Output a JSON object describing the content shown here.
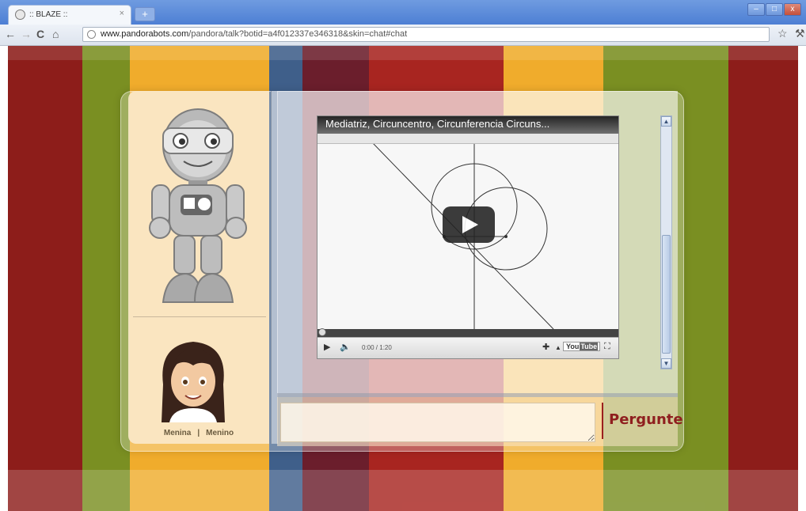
{
  "browser": {
    "tab_title": ":: BLAZE ::",
    "tab_close": "×",
    "new_tab": "+",
    "url_domain": "www.pandorabots.com",
    "url_path": "/pandora/talk?botid=a4f012337e346318&skin=chat#chat",
    "window_buttons": [
      "–",
      "□",
      "x"
    ]
  },
  "video": {
    "title": "Mediatriz, Circuncentro, Circunferencia Circuns...",
    "time": "0:00 / 1:20",
    "logo_you": "You",
    "logo_tube": "Tube"
  },
  "character_switch": {
    "girl": "Menina",
    "separator": "|",
    "boy": "Menino"
  },
  "input": {
    "value": "",
    "button": "Pergunte"
  },
  "colors": {
    "stripes": [
      "#8d1d1a",
      "#7a8f22",
      "#f0ac2c",
      "#3f5f8a",
      "#6b1e2c",
      "#a82520",
      "#f0ac2c",
      "#7a8f22",
      "#8d1d1a"
    ],
    "button_text": "#8f1f1f"
  }
}
